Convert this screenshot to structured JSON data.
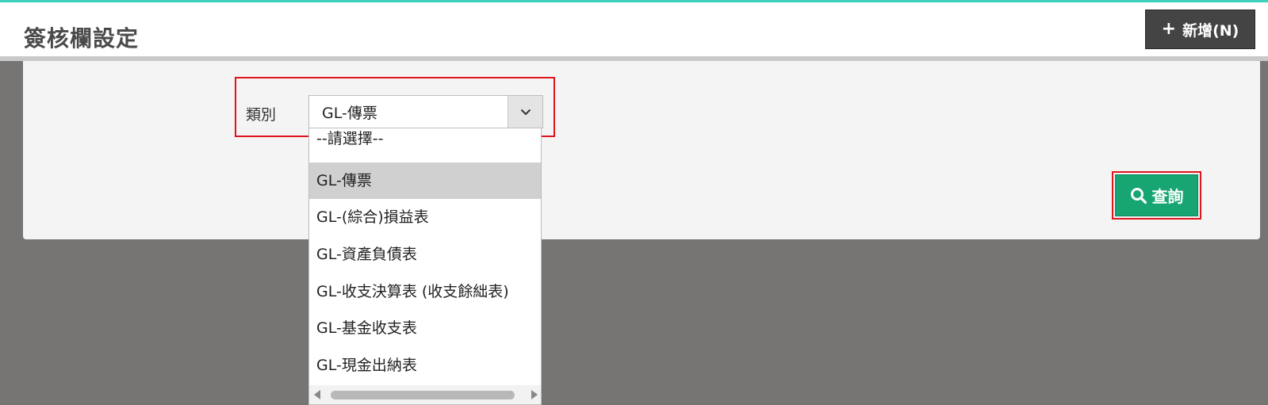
{
  "header": {
    "title": "簽核欄設定",
    "add_button": {
      "plus": "+",
      "label": "新增(N)"
    }
  },
  "filter": {
    "category_label": "類別",
    "selected_value": "GL-傳票",
    "options": [
      "--請選擇--",
      "GL-傳票",
      "GL-(綜合)損益表",
      "GL-資產負債表",
      "GL-收支決算表 (收支餘絀表)",
      "GL-基金收支表",
      "GL-現金出納表"
    ],
    "selected_index": 1
  },
  "query_button": {
    "label": "查詢"
  },
  "colors": {
    "accent_teal": "#3dd1bd",
    "query_green": "#17a672",
    "highlight_red": "#e0141c",
    "add_button_dark": "#444444"
  },
  "icons": {
    "add": "plus-icon",
    "dropdown": "chevron-down-icon",
    "query": "search-icon"
  }
}
